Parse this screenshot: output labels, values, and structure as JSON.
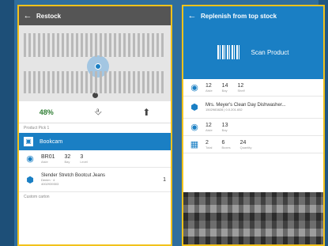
{
  "left": {
    "title": "Restock",
    "actions": {
      "percent": "48%"
    },
    "section_label": "Product Pick 1",
    "selected_item": {
      "label": "Bookcam"
    },
    "location": [
      {
        "value": "BR01",
        "label": "Aisle"
      },
      {
        "value": "32",
        "label": "Bay"
      },
      {
        "value": "3",
        "label": "Level"
      }
    ],
    "product": {
      "title": "Slender Stretch Bootcut Jeans",
      "sub1": "Denim · 4",
      "sub2": "4002939303",
      "qty": "1"
    },
    "footer_label": "Custom carton"
  },
  "right": {
    "title": "Replenish from top stock",
    "scan_label": "Scan Product",
    "loc1": [
      {
        "value": "12",
        "label": "Aisle"
      },
      {
        "value": "14",
        "label": "Bay"
      },
      {
        "value": "12",
        "label": "Shelf"
      }
    ],
    "product": {
      "title": "Mrs. Meyer's Clean Day Dishwasher...",
      "sub": "1502983828 | 0.0.201.652"
    },
    "loc2": [
      {
        "value": "12",
        "label": "Aisle"
      },
      {
        "value": "13",
        "label": "Bay"
      }
    ],
    "pallet": [
      {
        "value": "2",
        "label": "Total"
      },
      {
        "value": "6",
        "label": "Boxes"
      },
      {
        "value": "24",
        "label": "Quantity"
      }
    ]
  }
}
